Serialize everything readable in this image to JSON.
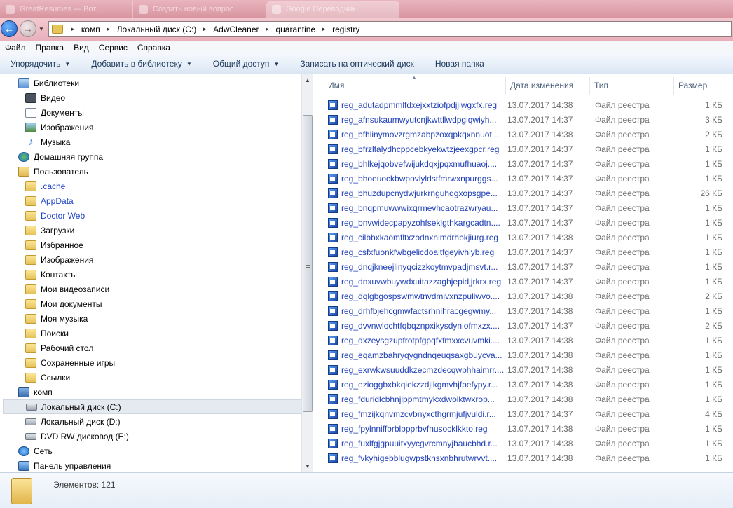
{
  "tabs": [
    {
      "label": "GreatResumes — Вот ..."
    },
    {
      "label": "Создать новый вопрос"
    },
    {
      "label": "Google Переводчик"
    }
  ],
  "breadcrumb": [
    "комп",
    "Локальный диск (C:)",
    "AdwCleaner",
    "quarantine",
    "registry"
  ],
  "menu": [
    "Файл",
    "Правка",
    "Вид",
    "Сервис",
    "Справка"
  ],
  "toolbar": {
    "organize": "Упорядочить",
    "add_library": "Добавить в библиотеку",
    "share": "Общий доступ",
    "burn": "Записать на оптический диск",
    "new_folder": "Новая папка"
  },
  "tree": [
    {
      "label": "Библиотеки",
      "icon": "lib",
      "indent": 0
    },
    {
      "label": "Видео",
      "icon": "video",
      "indent": 1
    },
    {
      "label": "Документы",
      "icon": "doc",
      "indent": 1
    },
    {
      "label": "Изображения",
      "icon": "img",
      "indent": 1
    },
    {
      "label": "Музыка",
      "icon": "music",
      "indent": 1
    },
    {
      "label": "Домашняя группа",
      "icon": "group",
      "indent": 0
    },
    {
      "label": "Пользователь",
      "icon": "user",
      "indent": 0
    },
    {
      "label": ".cache",
      "icon": "folder",
      "indent": 1,
      "blue": true
    },
    {
      "label": "AppData",
      "icon": "folder",
      "indent": 1,
      "blue": true
    },
    {
      "label": "Doctor Web",
      "icon": "folder",
      "indent": 1,
      "blue": true
    },
    {
      "label": "Загрузки",
      "icon": "folder",
      "indent": 1
    },
    {
      "label": "Избранное",
      "icon": "folder",
      "indent": 1
    },
    {
      "label": "Изображения",
      "icon": "folder",
      "indent": 1
    },
    {
      "label": "Контакты",
      "icon": "folder",
      "indent": 1
    },
    {
      "label": "Мои видеозаписи",
      "icon": "folder",
      "indent": 1
    },
    {
      "label": "Мои документы",
      "icon": "folder",
      "indent": 1
    },
    {
      "label": "Моя музыка",
      "icon": "folder",
      "indent": 1
    },
    {
      "label": "Поиски",
      "icon": "folder",
      "indent": 1
    },
    {
      "label": "Рабочий стол",
      "icon": "folder",
      "indent": 1
    },
    {
      "label": "Сохраненные игры",
      "icon": "folder",
      "indent": 1
    },
    {
      "label": "Ссылки",
      "icon": "folder",
      "indent": 1
    },
    {
      "label": "комп",
      "icon": "comp",
      "indent": 0
    },
    {
      "label": "Локальный диск (C:)",
      "icon": "drive",
      "indent": 1,
      "selected": true
    },
    {
      "label": "Локальный диск (D:)",
      "icon": "drive",
      "indent": 1
    },
    {
      "label": "DVD RW дисковод (E:)",
      "icon": "dvd",
      "indent": 1
    },
    {
      "label": "Сеть",
      "icon": "net",
      "indent": 0
    },
    {
      "label": "Панель управления",
      "icon": "cp",
      "indent": 0
    }
  ],
  "columns": {
    "name": "Имя",
    "date": "Дата изменения",
    "type": "Тип",
    "size": "Размер"
  },
  "files": [
    {
      "name": "reg_adutadpmmlfdxejxxtziofpdjjiwgxfx.reg",
      "date": "13.07.2017 14:38",
      "type": "Файл реестра",
      "size": "1 КБ"
    },
    {
      "name": "reg_afnsukaumwyutcnjkwttllwdpgiqwiyh...",
      "date": "13.07.2017 14:37",
      "type": "Файл реестра",
      "size": "3 КБ"
    },
    {
      "name": "reg_bfhlinymovzrgmzabpzoxqpkqxnnuot...",
      "date": "13.07.2017 14:38",
      "type": "Файл реестра",
      "size": "2 КБ"
    },
    {
      "name": "reg_bfrzltalydhcppcebkyekwtzjeexgpcr.reg",
      "date": "13.07.2017 14:37",
      "type": "Файл реестра",
      "size": "1 КБ"
    },
    {
      "name": "reg_bhlkejqobvefwijukdqxjpqxmufhuaoj....",
      "date": "13.07.2017 14:37",
      "type": "Файл реестра",
      "size": "1 КБ"
    },
    {
      "name": "reg_bhoeuockbwpovlyldstfmrwxnpurggs...",
      "date": "13.07.2017 14:37",
      "type": "Файл реестра",
      "size": "1 КБ"
    },
    {
      "name": "reg_bhuzdupcnydwjurkrnguhqgxopsgpe...",
      "date": "13.07.2017 14:37",
      "type": "Файл реестра",
      "size": "26 КБ"
    },
    {
      "name": "reg_bnqpmuwwwixqrmevhcaotrazwryau...",
      "date": "13.07.2017 14:37",
      "type": "Файл реестра",
      "size": "1 КБ"
    },
    {
      "name": "reg_bnvwidecpapyzohfseklgthkargcadtn....",
      "date": "13.07.2017 14:37",
      "type": "Файл реестра",
      "size": "1 КБ"
    },
    {
      "name": "reg_cilbbxkaomfltxzodnxnimdrhbkjiurg.reg",
      "date": "13.07.2017 14:38",
      "type": "Файл реестра",
      "size": "1 КБ"
    },
    {
      "name": "reg_csfxfuonkfwbgelicdoaltfgeyivhiyb.reg",
      "date": "13.07.2017 14:37",
      "type": "Файл реестра",
      "size": "1 КБ"
    },
    {
      "name": "reg_dnqjkneejlinyqcizzkoytmvpadjmsvt.r...",
      "date": "13.07.2017 14:37",
      "type": "Файл реестра",
      "size": "1 КБ"
    },
    {
      "name": "reg_dnxuvwbuywdxuitazzaghjepidjjrkrx.reg",
      "date": "13.07.2017 14:37",
      "type": "Файл реестра",
      "size": "1 КБ"
    },
    {
      "name": "reg_dqlgbgospswmwtnvdmivxnzpuliwvo....",
      "date": "13.07.2017 14:38",
      "type": "Файл реестра",
      "size": "2 КБ"
    },
    {
      "name": "reg_drhfbjehcgmwfactsrhnihracgegwmy...",
      "date": "13.07.2017 14:38",
      "type": "Файл реестра",
      "size": "1 КБ"
    },
    {
      "name": "reg_dvvnwlochtfqbqznpxikysdynlofmxzx....",
      "date": "13.07.2017 14:37",
      "type": "Файл реестра",
      "size": "2 КБ"
    },
    {
      "name": "reg_dxzeysgzupfrotpfgpqfxfmxxcvuvmki....",
      "date": "13.07.2017 14:38",
      "type": "Файл реестра",
      "size": "1 КБ"
    },
    {
      "name": "reg_eqamzbahryqygndnqeuqsaxgbuycva...",
      "date": "13.07.2017 14:38",
      "type": "Файл реестра",
      "size": "1 КБ"
    },
    {
      "name": "reg_exrwkwsuuddkzecmzdecqwphhaimrr....",
      "date": "13.07.2017 14:38",
      "type": "Файл реестра",
      "size": "1 КБ"
    },
    {
      "name": "reg_ezioggbxbkqiekzzdjlkgmvhjfpefypy.r...",
      "date": "13.07.2017 14:38",
      "type": "Файл реестра",
      "size": "1 КБ"
    },
    {
      "name": "reg_fduridlcbhnjlppmtmykxdwolktwxrop...",
      "date": "13.07.2017 14:38",
      "type": "Файл реестра",
      "size": "1 КБ"
    },
    {
      "name": "reg_fmzijkqnvmzcvbnyxcthgrmjufjvuldi.r...",
      "date": "13.07.2017 14:37",
      "type": "Файл реестра",
      "size": "4 КБ"
    },
    {
      "name": "reg_fpylnniffbrblppprbvfnusocklkkto.reg",
      "date": "13.07.2017 14:38",
      "type": "Файл реестра",
      "size": "1 КБ"
    },
    {
      "name": "reg_fuxlfgjgpuuitxyycgvrcmnyjbaucbhd.r...",
      "date": "13.07.2017 14:38",
      "type": "Файл реестра",
      "size": "1 КБ"
    },
    {
      "name": "reg_fvkyhigebblugwpstknsxnbhrutwrvvt....",
      "date": "13.07.2017 14:38",
      "type": "Файл реестра",
      "size": "1 КБ"
    }
  ],
  "status": {
    "items_count": "Элементов: 121"
  }
}
